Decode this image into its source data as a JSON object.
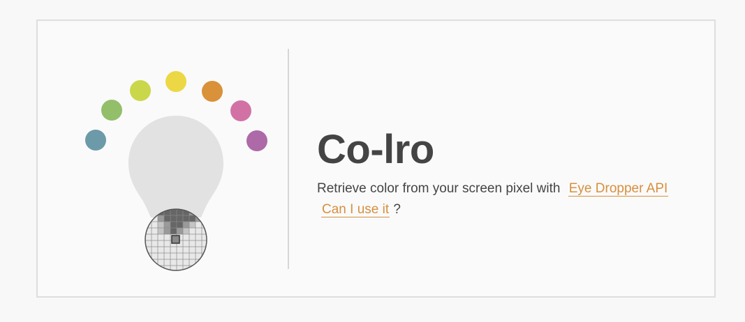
{
  "app": {
    "title": "Co-lro",
    "description_prefix": "Retrieve color from your screen pixel with",
    "eye_dropper_link": "Eye Dropper API",
    "can_i_use_link": "Can I use it",
    "suffix": "?"
  },
  "palette": {
    "swatches": [
      {
        "name": "teal",
        "color": "#6c9aa8"
      },
      {
        "name": "green",
        "color": "#93be6a"
      },
      {
        "name": "lime",
        "color": "#cad74a"
      },
      {
        "name": "yellow",
        "color": "#ecd844"
      },
      {
        "name": "orange",
        "color": "#d9913a"
      },
      {
        "name": "pink",
        "color": "#d272a4"
      },
      {
        "name": "purple",
        "color": "#ad69a8"
      }
    ],
    "bulb_color": "#e2e2e2",
    "accent": "#d6903e",
    "text_color": "#444444"
  },
  "icons": {
    "logo": "lightbulb-magnifier-icon"
  }
}
